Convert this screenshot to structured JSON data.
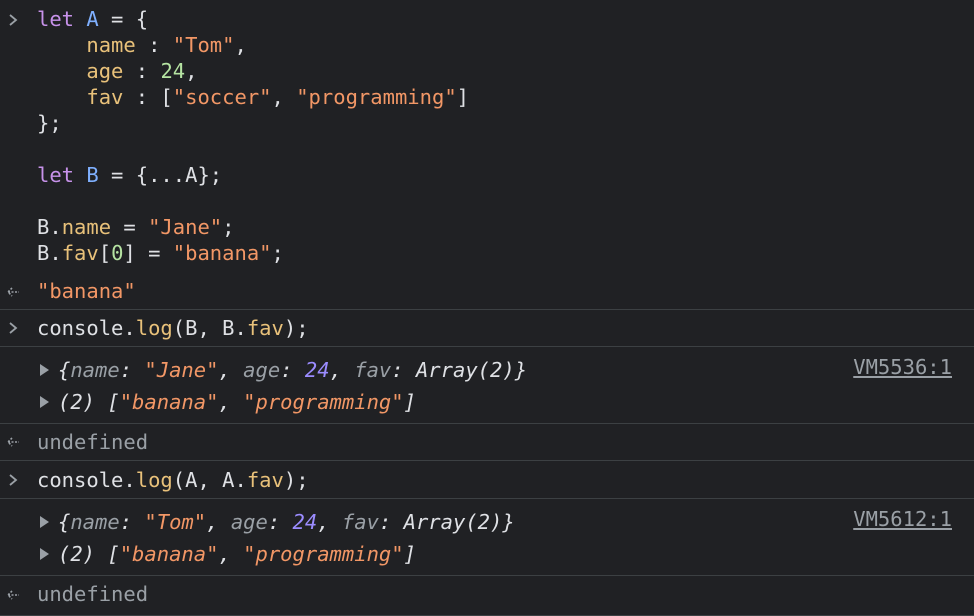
{
  "input1": {
    "lines": [
      {
        "t": [
          [
            "kw",
            "let"
          ],
          [
            "punc",
            " "
          ],
          [
            "var",
            "A"
          ],
          [
            "punc",
            " = {"
          ]
        ]
      },
      {
        "t": [
          [
            "punc",
            "    "
          ],
          [
            "prop",
            "name"
          ],
          [
            "punc",
            " : "
          ],
          [
            "str",
            "\"Tom\""
          ],
          [
            "punc",
            ","
          ]
        ]
      },
      {
        "t": [
          [
            "punc",
            "    "
          ],
          [
            "prop",
            "age"
          ],
          [
            "punc",
            " : "
          ],
          [
            "num",
            "24"
          ],
          [
            "punc",
            ","
          ]
        ]
      },
      {
        "t": [
          [
            "punc",
            "    "
          ],
          [
            "prop",
            "fav"
          ],
          [
            "punc",
            " : ["
          ],
          [
            "str",
            "\"soccer\""
          ],
          [
            "punc",
            ", "
          ],
          [
            "str",
            "\"programming\""
          ],
          [
            "punc",
            "]"
          ]
        ]
      },
      {
        "t": [
          [
            "punc",
            "};"
          ]
        ]
      },
      {
        "t": []
      },
      {
        "t": [
          [
            "kw",
            "let"
          ],
          [
            "punc",
            " "
          ],
          [
            "var",
            "B"
          ],
          [
            "punc",
            " = {"
          ],
          [
            "dots",
            "..."
          ],
          [
            "punc",
            "A};"
          ]
        ]
      },
      {
        "t": []
      },
      {
        "t": [
          [
            "punc",
            "B."
          ],
          [
            "prop",
            "name"
          ],
          [
            "punc",
            " = "
          ],
          [
            "str",
            "\"Jane\""
          ],
          [
            "punc",
            ";"
          ]
        ]
      },
      {
        "t": [
          [
            "punc",
            "B."
          ],
          [
            "prop",
            "fav"
          ],
          [
            "punc",
            "["
          ],
          [
            "num",
            "0"
          ],
          [
            "punc",
            "] = "
          ],
          [
            "str",
            "\"banana\""
          ],
          [
            "punc",
            ";"
          ]
        ]
      }
    ]
  },
  "result1": "\"banana\"",
  "input2": {
    "parts": [
      [
        "punc",
        "console."
      ],
      [
        "method",
        "log"
      ],
      [
        "punc",
        "(B, B."
      ],
      [
        "prop",
        "fav"
      ],
      [
        "punc",
        ");"
      ]
    ]
  },
  "log2": {
    "source": "VM5536:1",
    "obj": [
      [
        "obj-plain",
        "{"
      ],
      [
        "obj-key",
        "name"
      ],
      [
        "obj-plain",
        ": "
      ],
      [
        "obj-str",
        "\"Jane\""
      ],
      [
        "obj-plain",
        ", "
      ],
      [
        "obj-key",
        "age"
      ],
      [
        "obj-plain",
        ": "
      ],
      [
        "obj-num",
        "24"
      ],
      [
        "obj-plain",
        ", "
      ],
      [
        "obj-key",
        "fav"
      ],
      [
        "obj-plain",
        ": Array(2)}"
      ]
    ],
    "arr": [
      [
        "obj-plain",
        "(2) ["
      ],
      [
        "obj-str",
        "\"banana\""
      ],
      [
        "obj-plain",
        ", "
      ],
      [
        "obj-str",
        "\"programming\""
      ],
      [
        "obj-plain",
        "]"
      ]
    ]
  },
  "result2": "undefined",
  "input3": {
    "parts": [
      [
        "punc",
        "console."
      ],
      [
        "method",
        "log"
      ],
      [
        "punc",
        "(A, A."
      ],
      [
        "prop",
        "fav"
      ],
      [
        "punc",
        ");"
      ]
    ]
  },
  "log3": {
    "source": "VM5612:1",
    "obj": [
      [
        "obj-plain",
        "{"
      ],
      [
        "obj-key",
        "name"
      ],
      [
        "obj-plain",
        ": "
      ],
      [
        "obj-str",
        "\"Tom\""
      ],
      [
        "obj-plain",
        ", "
      ],
      [
        "obj-key",
        "age"
      ],
      [
        "obj-plain",
        ": "
      ],
      [
        "obj-num",
        "24"
      ],
      [
        "obj-plain",
        ", "
      ],
      [
        "obj-key",
        "fav"
      ],
      [
        "obj-plain",
        ": Array(2)}"
      ]
    ],
    "arr": [
      [
        "obj-plain",
        "(2) ["
      ],
      [
        "obj-str",
        "\"banana\""
      ],
      [
        "obj-plain",
        ", "
      ],
      [
        "obj-str",
        "\"programming\""
      ],
      [
        "obj-plain",
        "]"
      ]
    ]
  },
  "result3": "undefined",
  "icons": {
    "input": "chevron-right-icon",
    "result": "return-arrow-icon",
    "expand": "expand-triangle-icon"
  }
}
